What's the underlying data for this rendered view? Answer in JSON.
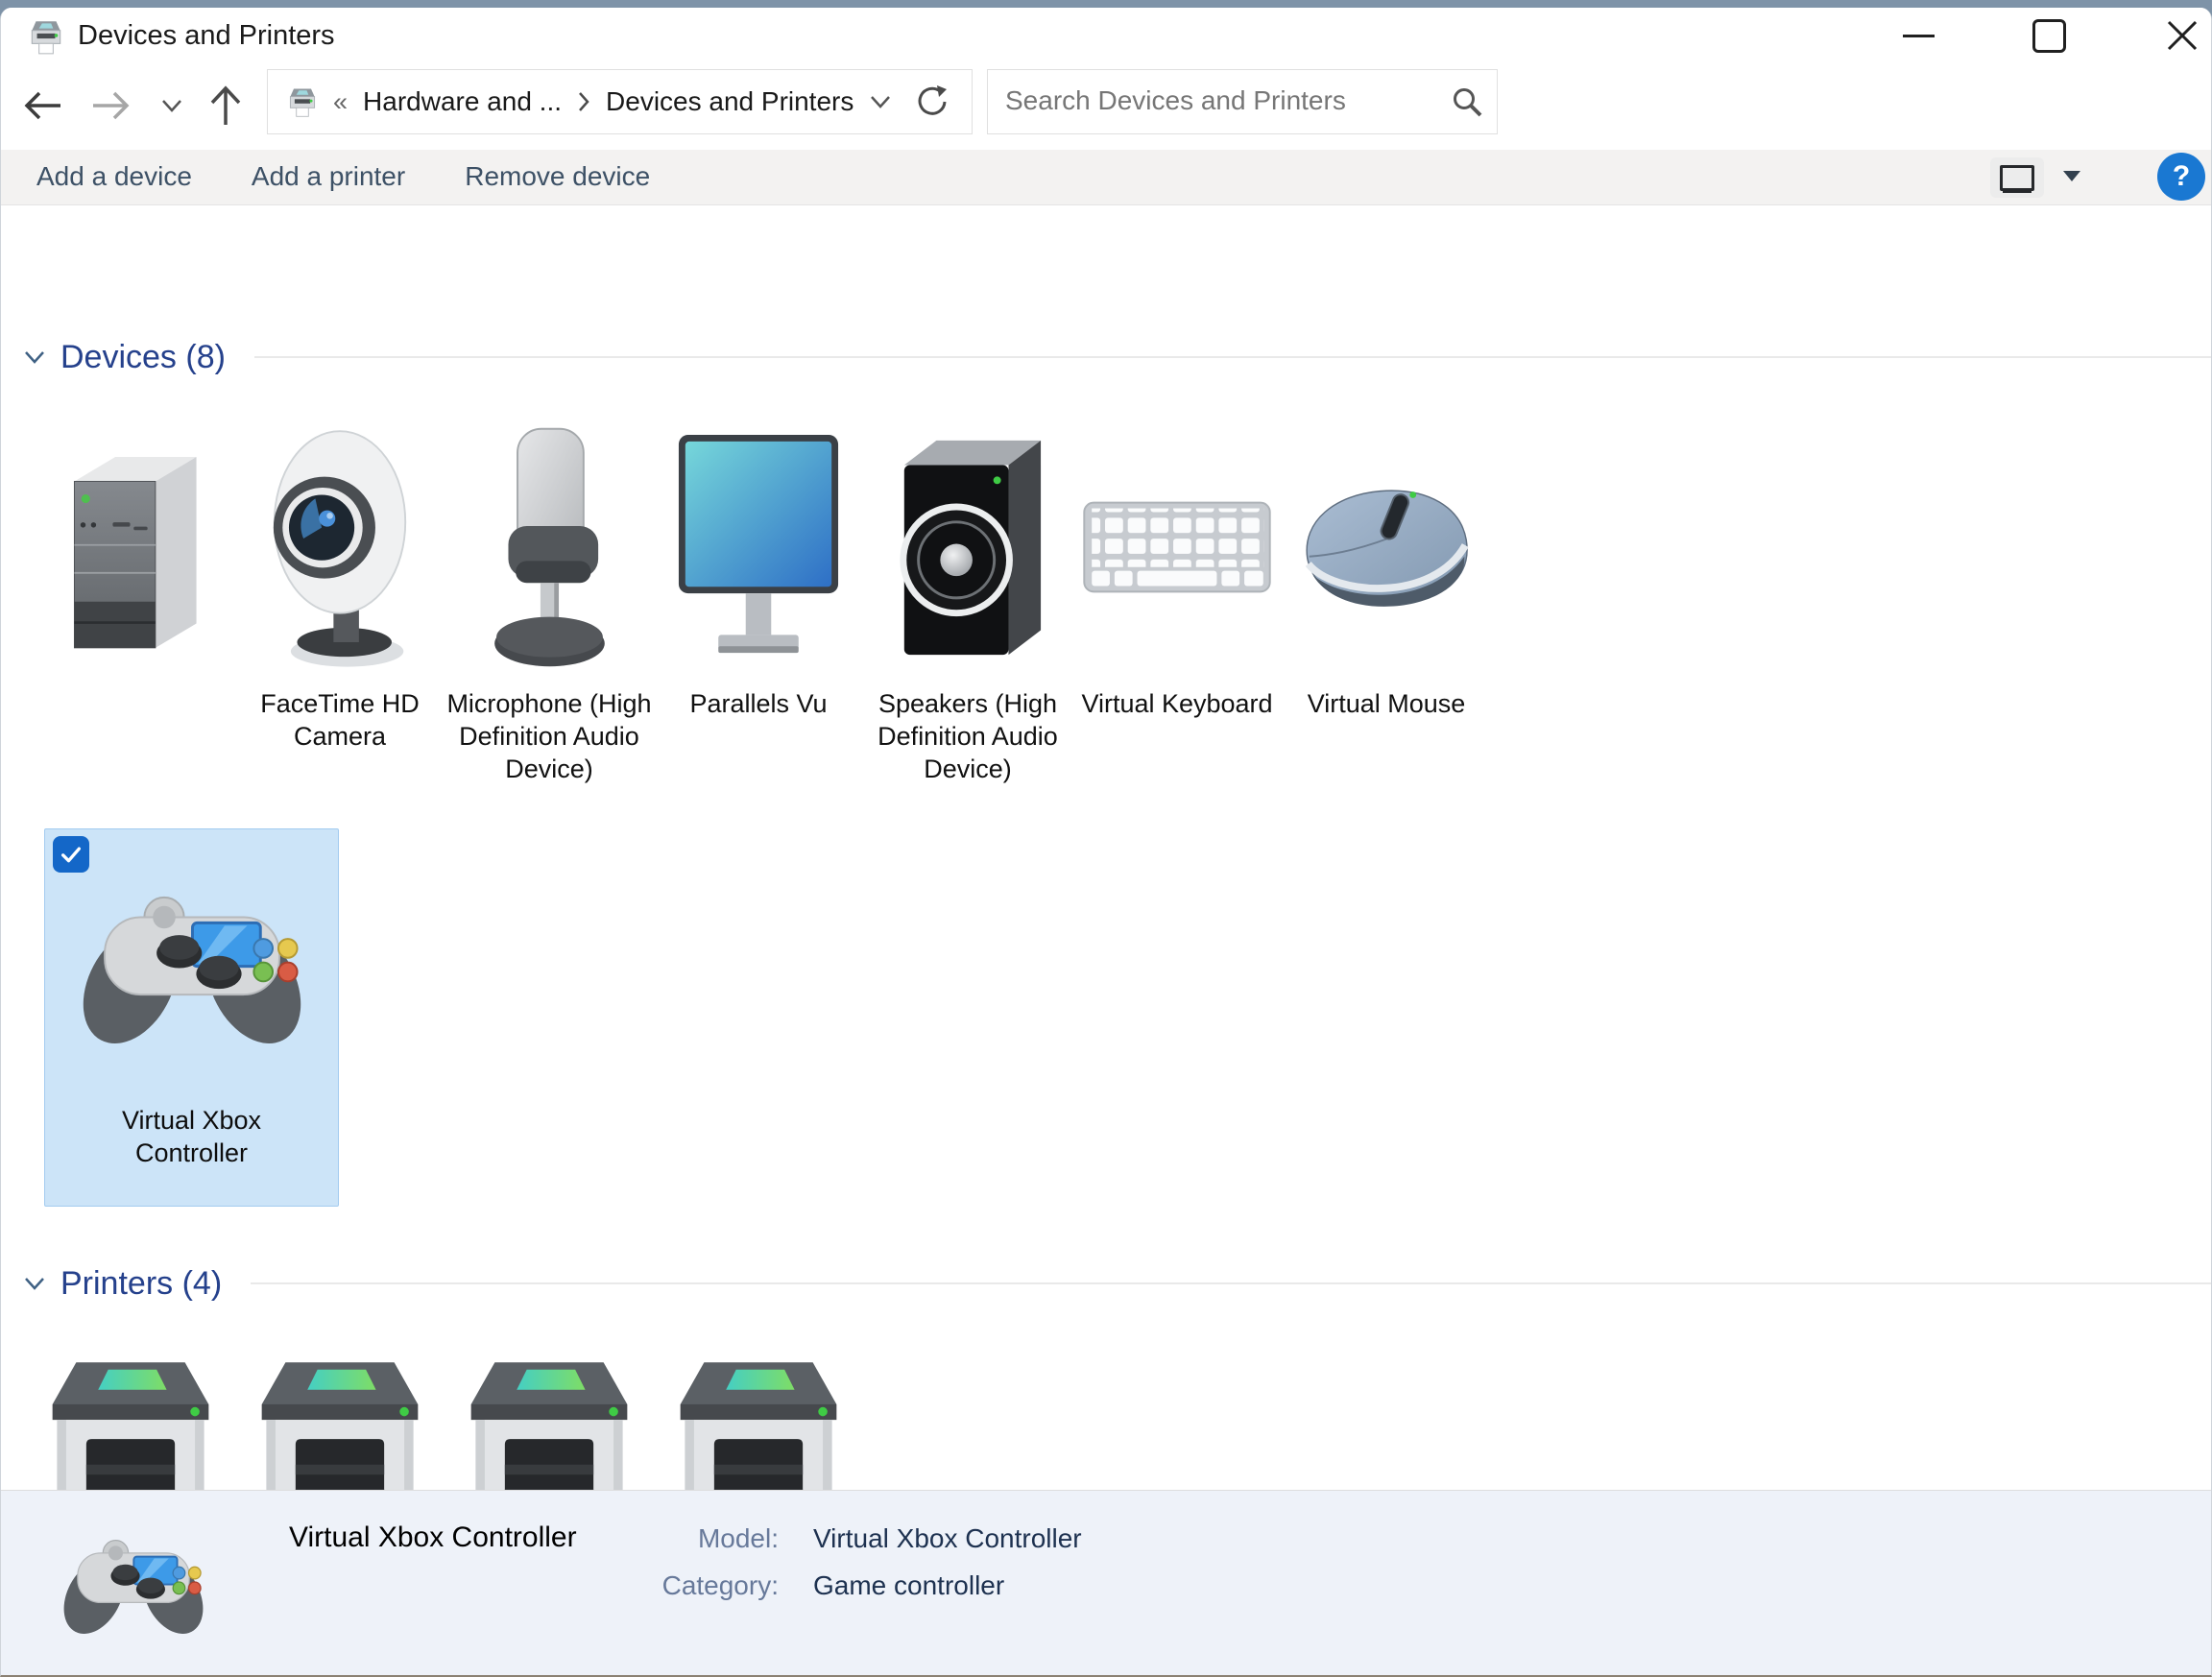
{
  "window_title": "Devices and Printers",
  "titlebar": {
    "minimize": "minimize",
    "maximize": "maximize",
    "close": "close"
  },
  "navigation": {
    "breadcrumb": {
      "overflow": "«",
      "parent": "Hardware and ...",
      "separator": "›",
      "current": "Devices and Printers"
    },
    "search_placeholder": "Search Devices and Printers"
  },
  "toolbar": {
    "add_device": "Add a device",
    "add_printer": "Add a printer",
    "remove_device": "Remove device",
    "help": "?"
  },
  "sections": {
    "devices_title": "Devices (8)",
    "printers_title": "Printers (4)"
  },
  "devices": [
    {
      "name": "",
      "icon": "computer-tower-icon"
    },
    {
      "name": "FaceTime HD Camera",
      "icon": "webcam-icon"
    },
    {
      "name": "Microphone (High Definition Audio Device)",
      "icon": "microphone-icon"
    },
    {
      "name": "Parallels Vu",
      "icon": "monitor-icon"
    },
    {
      "name": "Speakers (High Definition Audio Device)",
      "icon": "speaker-icon"
    },
    {
      "name": "Virtual Keyboard",
      "icon": "keyboard-icon"
    },
    {
      "name": "Virtual Mouse",
      "icon": "mouse-icon"
    }
  ],
  "selected_device": {
    "name": "Virtual Xbox Controller",
    "icon": "game-controller-icon",
    "checked": true
  },
  "printers": [
    {
      "icon": "printer-icon"
    },
    {
      "icon": "printer-icon"
    },
    {
      "icon": "printer-icon"
    },
    {
      "icon": "printer-icon"
    }
  ],
  "details": {
    "title": "Virtual Xbox Controller",
    "model_label": "Model:",
    "model_value": "Virtual Xbox Controller",
    "category_label": "Category:",
    "category_value": "Game controller"
  },
  "colors": {
    "accent": "#1467c8",
    "selection_bg": "#cce4f8",
    "selection_border": "#a3cbf0",
    "section_title": "#25418c",
    "help_button": "#1a78d2",
    "pane_bg": "#eef2f9",
    "status_led": "#3fcb45"
  }
}
